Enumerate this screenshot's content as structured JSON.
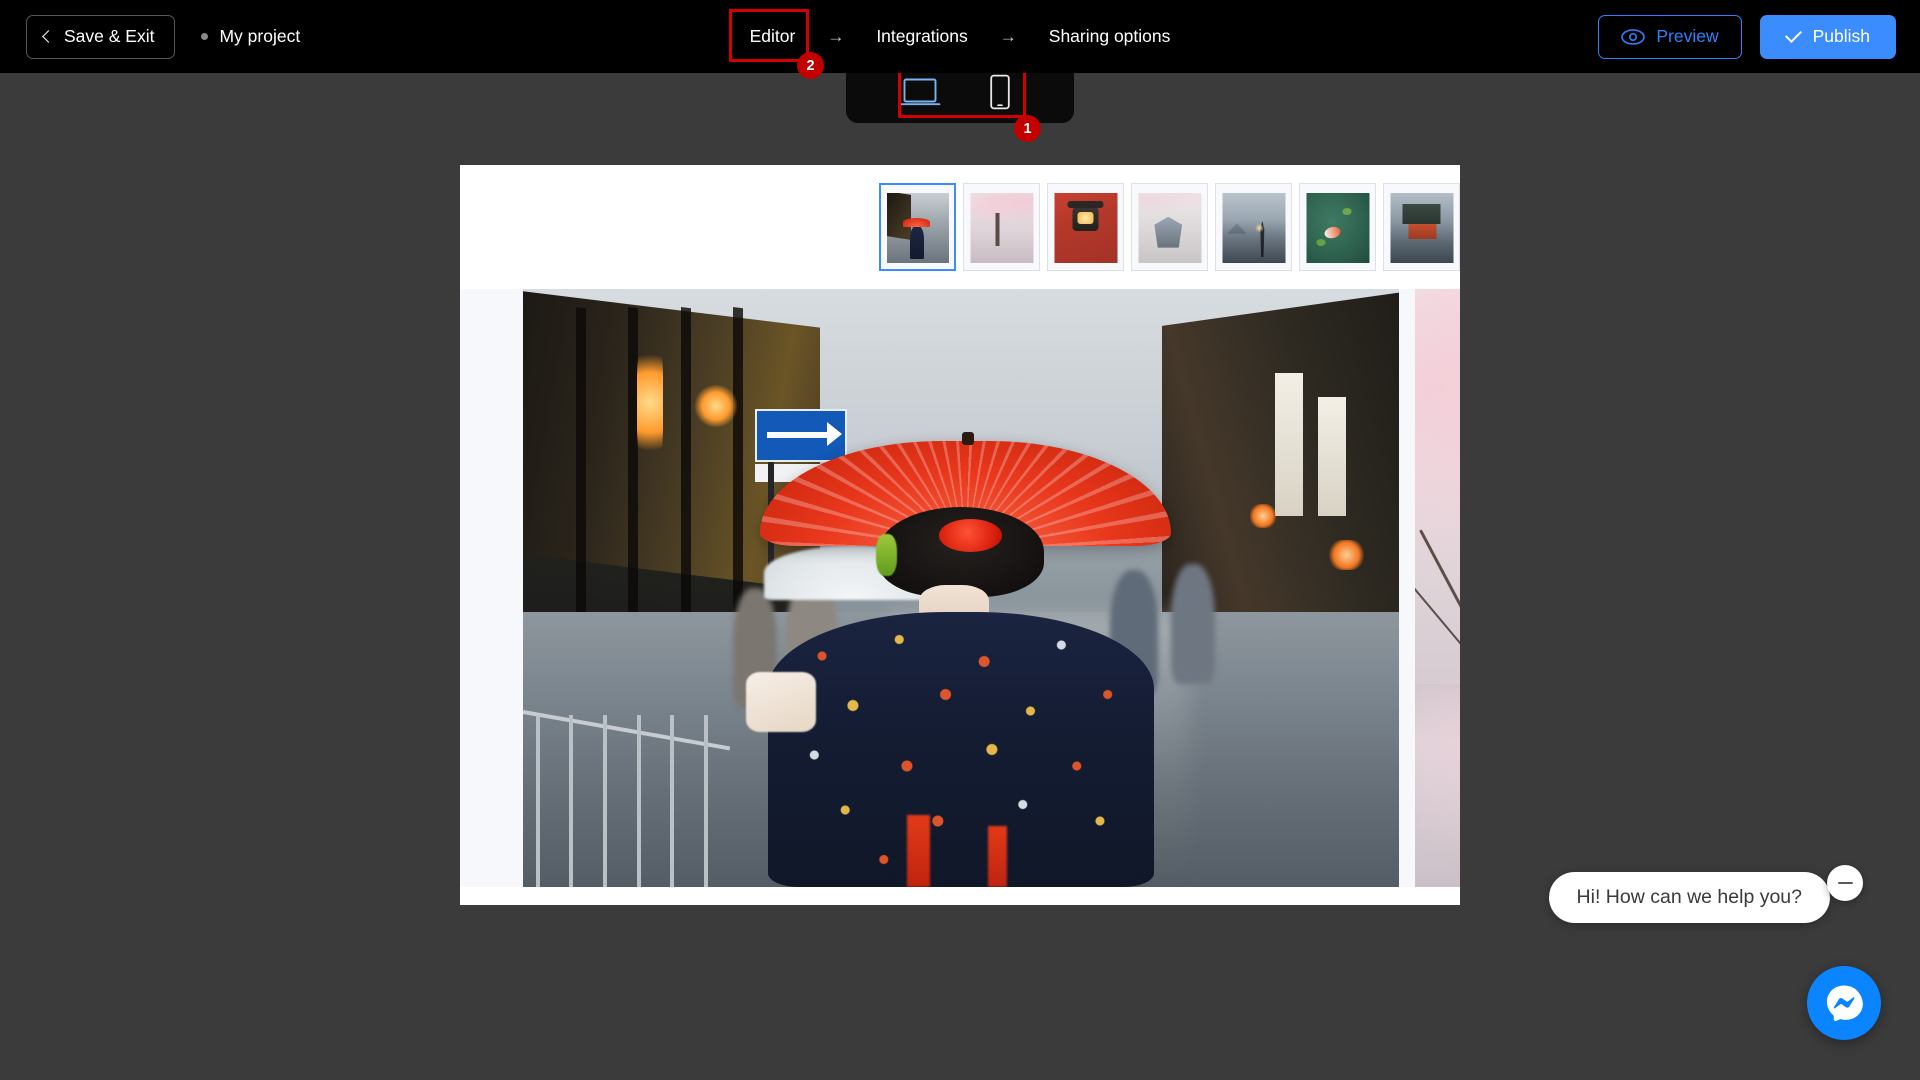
{
  "header": {
    "save_exit_label": "Save & Exit",
    "project_name": "My project",
    "back_icon": "chevron-left-icon",
    "status_dot_icon": "unsaved-dot-icon",
    "steps": [
      {
        "label": "Editor",
        "active": true
      },
      {
        "label": "Integrations",
        "active": false
      },
      {
        "label": "Sharing options",
        "active": false
      }
    ],
    "step_separator": "→",
    "preview_label": "Preview",
    "preview_icon": "eye-icon",
    "publish_label": "Publish",
    "publish_icon": "check-icon",
    "colors": {
      "bar_background": "#000000",
      "accent_blue": "#3b8cff",
      "preview_border": "#2f80ff"
    }
  },
  "device_toggle": {
    "desktop_icon": "desktop-icon",
    "mobile_icon": "mobile-icon",
    "selected": "desktop",
    "selected_color": "#7ab4ef",
    "unselected_color": "#e8e8e8",
    "background": "#0b0b0b"
  },
  "canvas": {
    "background": "#3b3b3b",
    "page_background": "#ffffff",
    "slider_background": "#f7f8fb"
  },
  "gallery": {
    "selected_index": 0,
    "thumbnails": [
      {
        "alt": "Kyoto street with maiko and red parasol",
        "style": "tp-kyoto",
        "selected": true
      },
      {
        "alt": "Cherry blossom trees reflected in water",
        "style": "tp-sakura",
        "selected": false
      },
      {
        "alt": "Red shrine with hanging lantern",
        "style": "tp-lantern",
        "selected": false
      },
      {
        "alt": "Japanese castle framed by blossoms",
        "style": "tp-castle",
        "selected": false
      },
      {
        "alt": "Pagoda silhouette at sunset",
        "style": "tp-pagoda",
        "selected": false
      },
      {
        "alt": "Koi fish in green pond",
        "style": "tp-koi",
        "selected": false
      },
      {
        "alt": "Temple in autumn light",
        "style": "tp-temple",
        "selected": false
      }
    ],
    "main_slide_alt": "Maiko walking with red parasol on a rainy Kyoto street",
    "next_slide_alt": "Cherry blossom tree"
  },
  "annotations": [
    {
      "badge": "1",
      "target": "device-toggle"
    },
    {
      "badge": "2",
      "target": "editor-step"
    }
  ],
  "chat": {
    "message": "Hi! How can we help you?",
    "minimize_icon": "minimize-icon",
    "launcher_icon": "messenger-icon",
    "launcher_color": "#0a84ff"
  }
}
